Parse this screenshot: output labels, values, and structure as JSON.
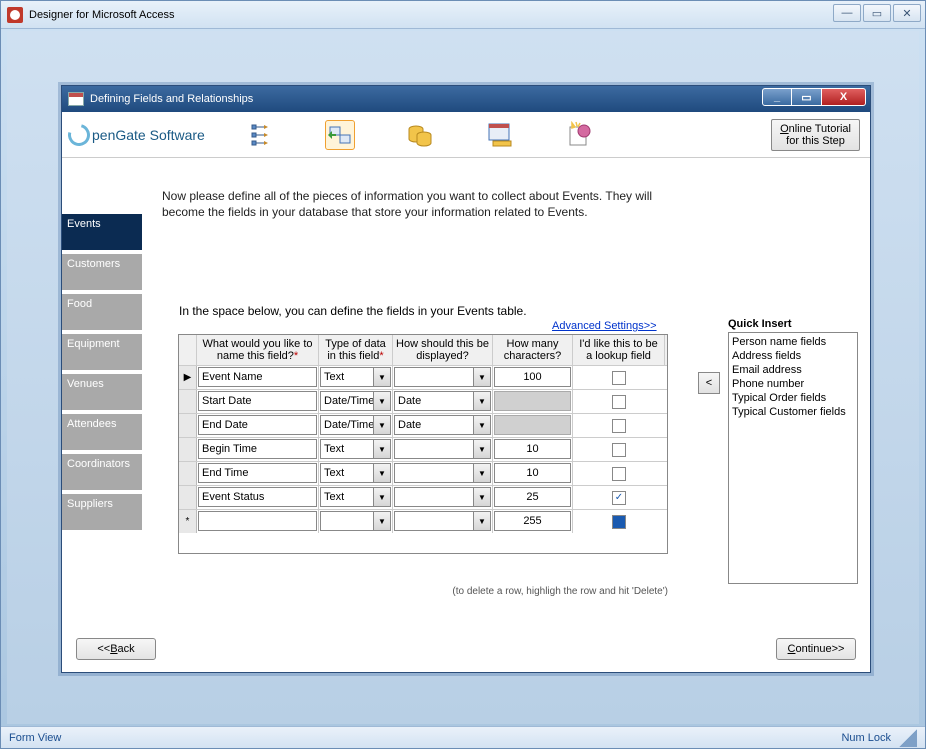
{
  "outer": {
    "title": "Designer for Microsoft Access"
  },
  "statusbar": {
    "left": "Form View",
    "right": "Num Lock"
  },
  "dialog": {
    "title": "Defining Fields and Relationships"
  },
  "brand": "penGate Software",
  "tutorial_btn": "Online Tutorial for this Step",
  "sidebar": {
    "items": [
      "Events",
      "Customers",
      "Food",
      "Equipment",
      "Venues",
      "Attendees",
      "Coordinators",
      "Suppliers"
    ],
    "active": 0
  },
  "instructions": "Now please define all of the pieces of information you want to collect about Events. They will become the fields in your database that store your information related to Events.",
  "sub_inst": "In the space below, you can define the fields in your Events table.",
  "adv_link": "Advanced Settings>>",
  "headers": {
    "h1": "What would you like to name this field?",
    "h2": "Type of data in this field",
    "h3": "How should this be displayed?",
    "h4": "How many characters?",
    "h5": "I'd like this to be a lookup field"
  },
  "rows": [
    {
      "mark": "▶",
      "name": "Event Name",
      "type": "Text",
      "disp": "",
      "chars": "100",
      "chk": false
    },
    {
      "mark": "",
      "name": "Start Date",
      "type": "Date/Time",
      "disp": "Date",
      "chars": "",
      "chk": false,
      "chars_dis": true
    },
    {
      "mark": "",
      "name": "End Date",
      "type": "Date/Time",
      "disp": "Date",
      "chars": "",
      "chk": false,
      "chars_dis": true
    },
    {
      "mark": "",
      "name": "Begin Time",
      "type": "Text",
      "disp": "",
      "chars": "10",
      "chk": false
    },
    {
      "mark": "",
      "name": "End Time",
      "type": "Text",
      "disp": "",
      "chars": "10",
      "chk": false
    },
    {
      "mark": "",
      "name": "Event Status",
      "type": "Text",
      "disp": "",
      "chars": "25",
      "chk": true
    },
    {
      "mark": "*",
      "name": "",
      "type": "",
      "disp": "",
      "chars": "255",
      "chk": "blue"
    }
  ],
  "delete_hint": "(to delete a row, highligh the row and hit 'Delete')",
  "qi": {
    "title": "Quick Insert",
    "items": [
      "Person name fields",
      "Address fields",
      "Email address",
      "Phone number",
      "Typical Order fields",
      "Typical Customer fields"
    ]
  },
  "nav": {
    "back": "<<Back",
    "cont": "Continue>>"
  },
  "insert_arrow": "<"
}
